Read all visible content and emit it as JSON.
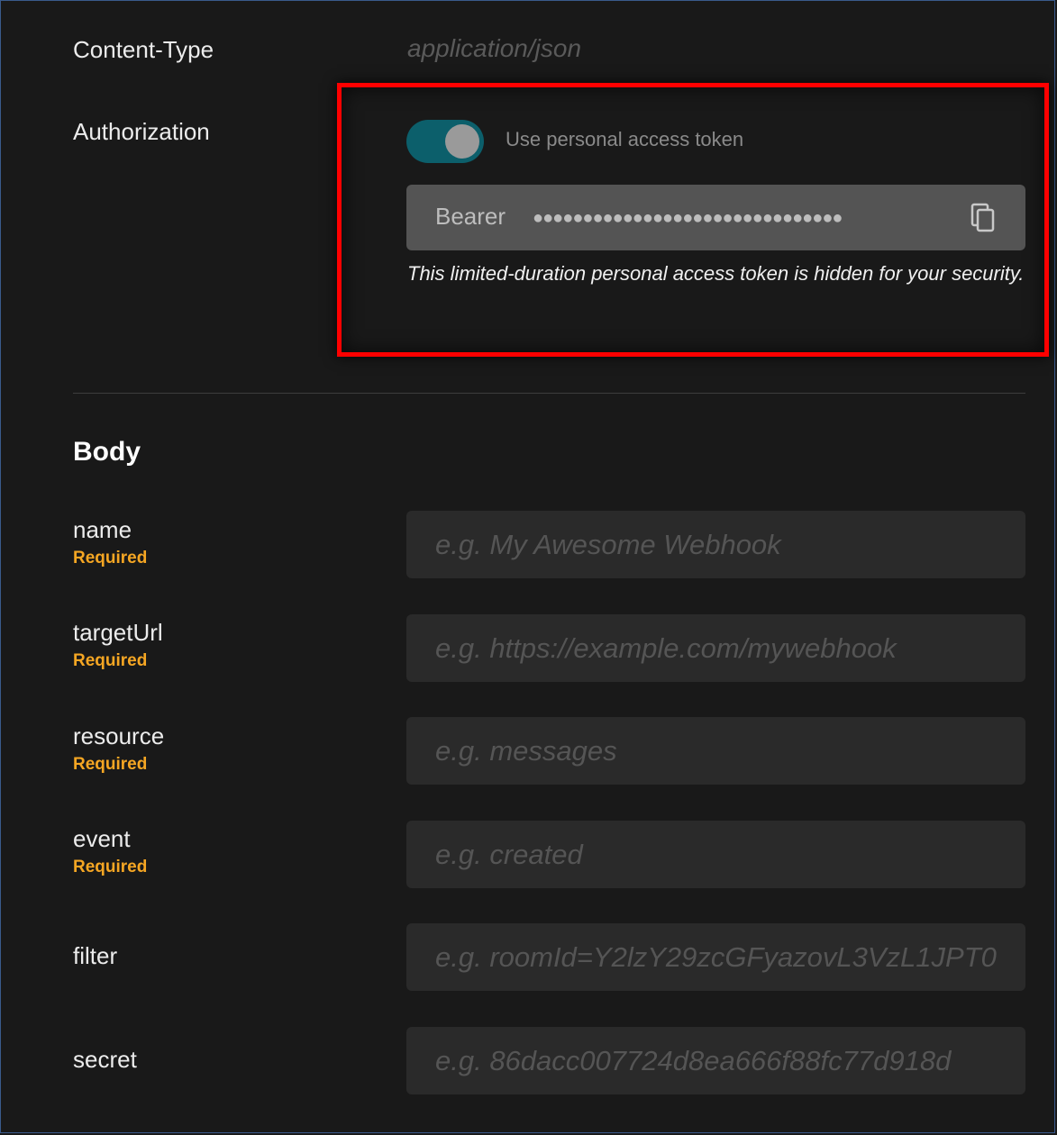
{
  "headers": {
    "content_type_label": "Content-Type",
    "content_type_value": "application/json",
    "authorization_label": "Authorization",
    "toggle_label": "Use personal access token",
    "toggle_on": true,
    "bearer_label": "Bearer",
    "token_mask": "●●●●●●●●●●●●●●●●●●●●●●●●●●●●●●●",
    "token_note": "This limited-duration personal access token is hidden for your security.",
    "highlight_color": "#ff0000"
  },
  "body": {
    "title": "Body",
    "required_text": "Required",
    "fields": {
      "name": {
        "label": "name",
        "placeholder": "e.g. My Awesome Webhook",
        "required": true
      },
      "targetUrl": {
        "label": "targetUrl",
        "placeholder": "e.g. https://example.com/mywebhook",
        "required": true
      },
      "resource": {
        "label": "resource",
        "placeholder": "e.g. messages",
        "required": true
      },
      "event": {
        "label": "event",
        "placeholder": "e.g. created",
        "required": true
      },
      "filter": {
        "label": "filter",
        "placeholder": "e.g. roomId=Y2lzY29zcGFyazovL3VzL1JPT0",
        "required": false
      },
      "secret": {
        "label": "secret",
        "placeholder": "e.g. 86dacc007724d8ea666f88fc77d918d",
        "required": false
      }
    }
  },
  "colors": {
    "background": "#191919",
    "required": "#f5a623",
    "toggle_track": "#0c5f6b",
    "input_background": "#2a2a2a"
  }
}
